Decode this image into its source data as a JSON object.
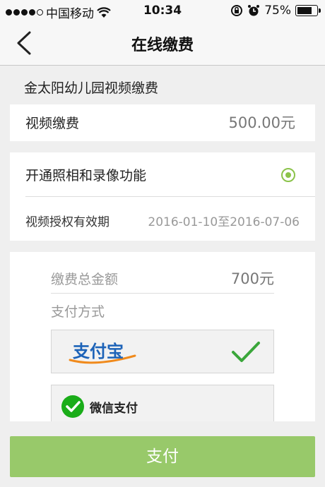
{
  "status_bar": {
    "carrier": "中国移动",
    "time": "10:34",
    "battery": "75%",
    "battery_level": 0.75
  },
  "nav": {
    "title": "在线缴费"
  },
  "section": {
    "title": "金太阳幼儿园视频缴费"
  },
  "video_fee": {
    "label": "视频缴费",
    "amount": "500.00元"
  },
  "feature": {
    "label": "开通照相和录像功能",
    "selected": true,
    "validity_label": "视频授权有效期",
    "validity_range": "2016-01-10至2016-07-06"
  },
  "payment": {
    "total_label": "缴费总金额",
    "total_value": "700元",
    "method_label": "支付方式",
    "alipay_label": "支付宝",
    "wechat_label": "微信支付",
    "selected_method": "alipay"
  },
  "actions": {
    "pay_label": "支付"
  },
  "colors": {
    "accent_green": "#8bc34a",
    "button_green": "#98c96a",
    "alipay_blue": "#1d63b8",
    "alipay_orange": "#f08a1c",
    "wechat_green": "#1aad19"
  }
}
